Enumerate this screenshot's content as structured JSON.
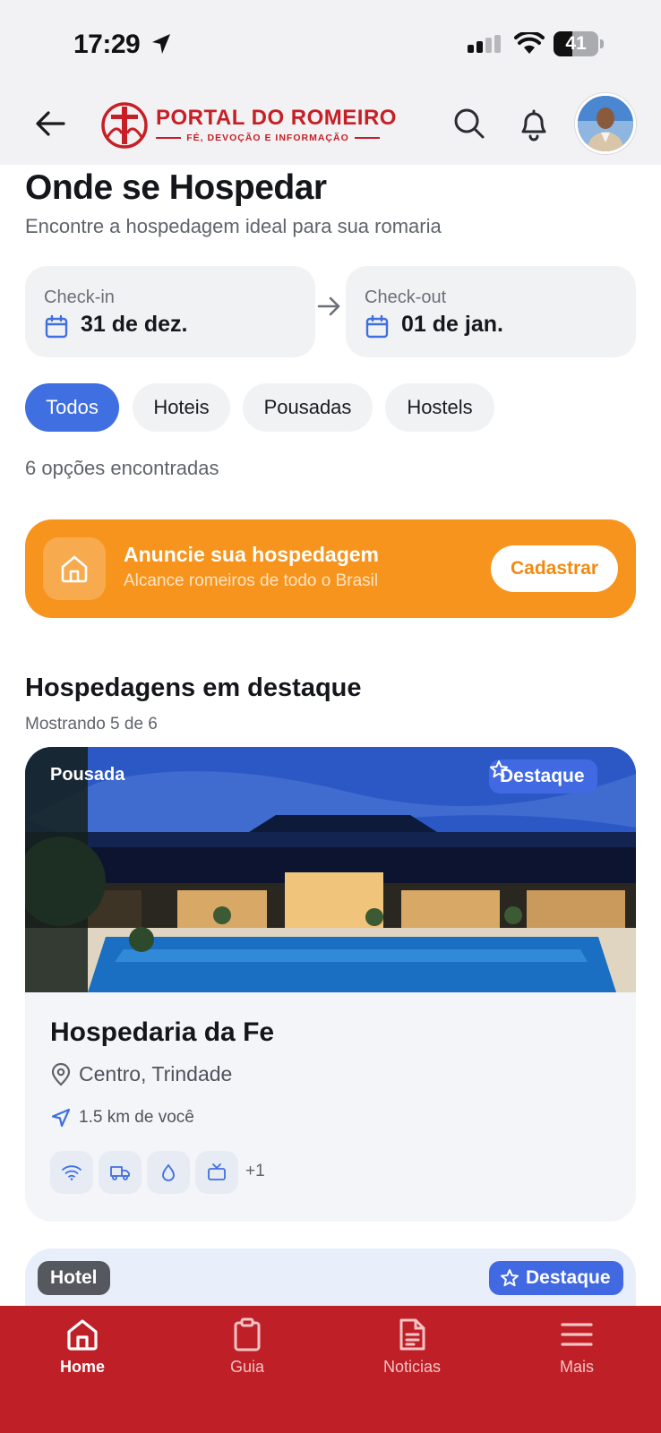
{
  "status_bar": {
    "time": "17:29",
    "battery": "41",
    "battery_level": 0.41
  },
  "header": {
    "logo_title": "PORTAL DO ROMEIRO",
    "logo_subtitle": "FÉ, DEVOÇÃO E INFORMAÇÃO",
    "icons": [
      "back-arrow-icon",
      "search-icon",
      "bell-icon",
      "avatar"
    ]
  },
  "page": {
    "title": "Onde se Hospedar",
    "subtitle": "Encontre a hospedagem ideal para sua romaria"
  },
  "dates": {
    "checkin_label": "Check-in",
    "checkin_value": "31 de dez.",
    "checkout_label": "Check-out",
    "checkout_value": "01 de jan."
  },
  "filters": [
    {
      "label": "Todos",
      "active": true
    },
    {
      "label": "Hoteis",
      "active": false
    },
    {
      "label": "Pousadas",
      "active": false
    },
    {
      "label": "Hostels",
      "active": false
    }
  ],
  "results_count": "6 opções encontradas",
  "promo": {
    "title": "Anuncie sua hospedagem",
    "subtitle": "Alcance romeiros de todo o Brasil",
    "button": "Cadastrar",
    "color": "#f7941d"
  },
  "featured": {
    "title": "Hospedagens em destaque",
    "subtitle": "Mostrando 5 de 6",
    "listings": [
      {
        "type": "Pousada",
        "badge": "Destaque",
        "name": "Hospedaria da Fe",
        "location": "Centro, Trindade",
        "distance": "1.5 km de você",
        "amenities": [
          "wifi-icon",
          "truck-icon",
          "water-drop-icon",
          "tv-icon"
        ],
        "more_amenities": "+1"
      },
      {
        "type": "Hotel",
        "badge": "Destaque"
      }
    ]
  },
  "tabs": [
    {
      "label": "Home",
      "icon": "home-icon",
      "active": true
    },
    {
      "label": "Guia",
      "icon": "clipboard-icon",
      "active": false
    },
    {
      "label": "Noticias",
      "icon": "document-icon",
      "active": false
    },
    {
      "label": "Mais",
      "icon": "menu-icon",
      "active": false
    }
  ],
  "colors": {
    "brand_red": "#bf1f26",
    "accent_blue": "#3f6fe0",
    "promo_orange": "#f7941d"
  }
}
